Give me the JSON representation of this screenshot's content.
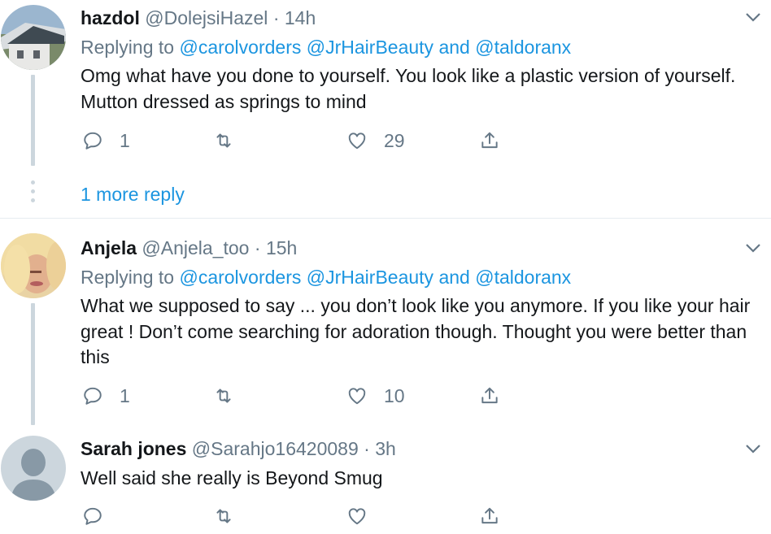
{
  "tweets": [
    {
      "name": "hazdol",
      "handle": "@DolejsiHazel",
      "separator": "·",
      "time": "14h",
      "replying_prefix": "Replying to",
      "replying_to_1": "@carolvorders",
      "replying_to_2": "@JrHairBeauty",
      "replying_and": "and",
      "replying_to_3": "@taldoranx",
      "text": "Omg what have you done to yourself. You look like a plastic version of yourself. Mutton dressed as springs to mind",
      "reply_count": "1",
      "retweet_count": "",
      "like_count": "29"
    },
    {
      "name": "Anjela",
      "handle": "@Anjela_too",
      "separator": "·",
      "time": "15h",
      "replying_prefix": "Replying to",
      "replying_to_1": "@carolvorders",
      "replying_to_2": "@JrHairBeauty",
      "replying_and": "and",
      "replying_to_3": "@taldoranx",
      "text": "What we supposed to say ... you don’t look like you anymore. If you like your hair great ! Don’t come searching for adoration though. Thought you were better than this",
      "reply_count": "1",
      "retweet_count": "",
      "like_count": "10"
    },
    {
      "name": "Sarah jones",
      "handle": "@Sarahjo16420089",
      "separator": "·",
      "time": "3h",
      "text": "Well said she really is Beyond Smug",
      "reply_count": "",
      "retweet_count": "",
      "like_count": ""
    }
  ],
  "more_replies_label": "1 more reply",
  "colors": {
    "link": "#1b95e0",
    "muted": "#657786",
    "text": "#14171a",
    "thread_line": "#ccd6dd",
    "divider": "#e6ecf0"
  },
  "icons": [
    "reply-icon",
    "retweet-icon",
    "like-icon",
    "share-icon",
    "chevron-down-icon"
  ]
}
